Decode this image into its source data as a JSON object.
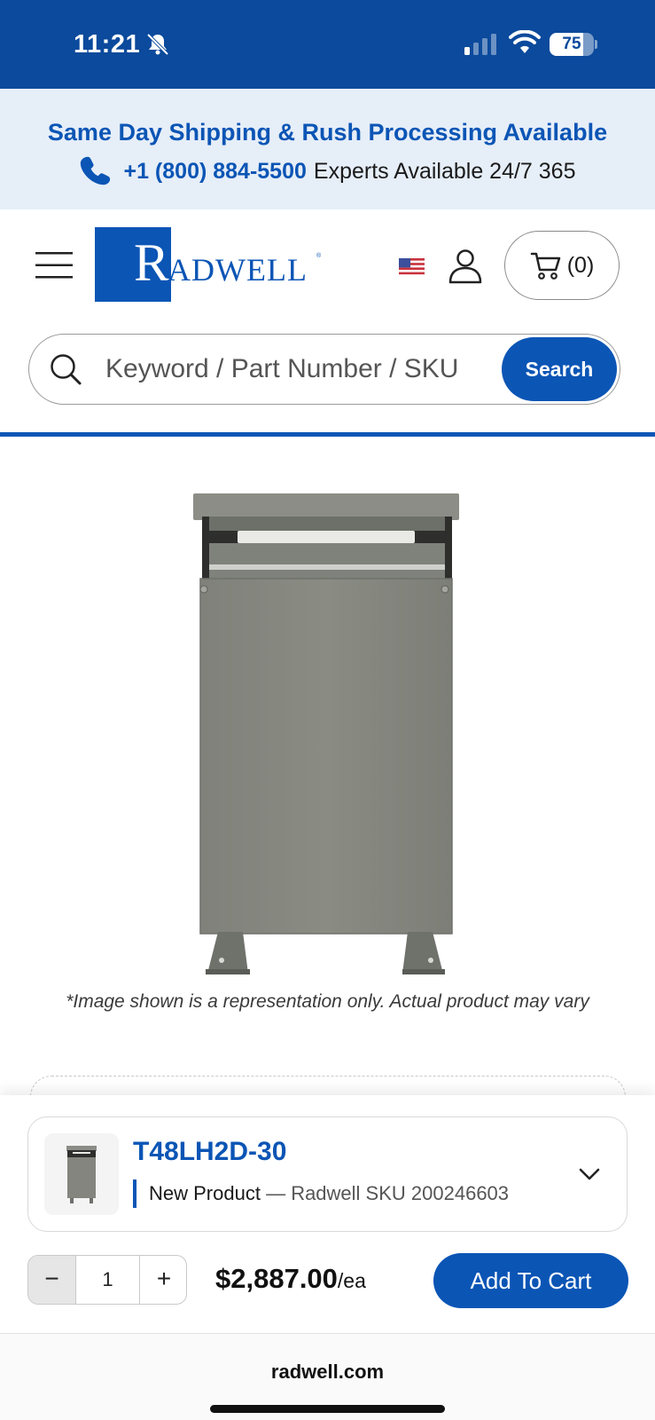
{
  "status_bar": {
    "time": "11:21",
    "battery_level": "75",
    "battery_fraction": 0.75
  },
  "promo": {
    "title": "Same Day Shipping & Rush Processing Available",
    "phone": "+1 (800) 884-5500",
    "availability": "Experts Available 24/7 365"
  },
  "header": {
    "logo_text": "RADWELL",
    "cart_count": "(0)",
    "country_flag": "us-flag-icon"
  },
  "search": {
    "placeholder": "Keyword / Part Number / SKU",
    "button_label": "Search"
  },
  "product": {
    "image_disclaimer": "*Image shown is a representation only. Actual product may vary",
    "part_number": "T48LH2D-30",
    "condition": "New Product",
    "sku_separator": " — ",
    "sku_label": "Radwell SKU 200246603",
    "price": "$2,887.00",
    "price_unit": "/ea",
    "quantity": "1",
    "qty_minus": "−",
    "qty_plus": "+",
    "add_to_cart_label": "Add To Cart"
  },
  "browser": {
    "url": "radwell.com"
  },
  "colors": {
    "brand_blue": "#0b55b5",
    "status_bar_blue": "#0b4a9c",
    "promo_bg": "#e6eef8"
  }
}
